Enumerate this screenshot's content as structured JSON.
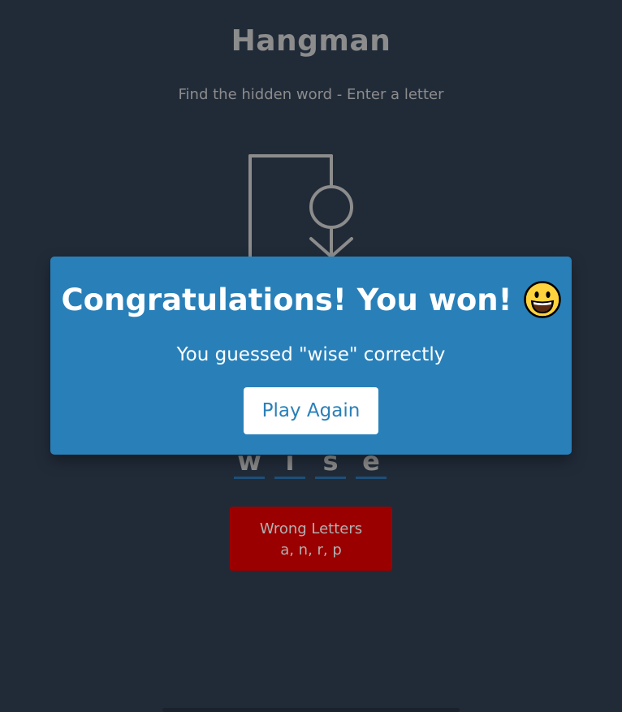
{
  "header": {
    "title": "Hangman",
    "subtitle": "Find the hidden word - Enter a letter"
  },
  "word": {
    "letters": [
      "w",
      "i",
      "s",
      "e"
    ]
  },
  "wrong_letters": {
    "label": "Wrong Letters",
    "letters": "a, n, r, p"
  },
  "popup": {
    "heading": "Congratulations! You won!",
    "message": "You guessed \"wise\" correctly",
    "play_again_label": "Play Again",
    "emoji": "grinning-face-icon"
  },
  "colors": {
    "background": "#212b38",
    "popup": "#2980b9",
    "wrong_box": "#9a0000",
    "figure": "#8c8c8c",
    "underline": "#1d4f78"
  }
}
